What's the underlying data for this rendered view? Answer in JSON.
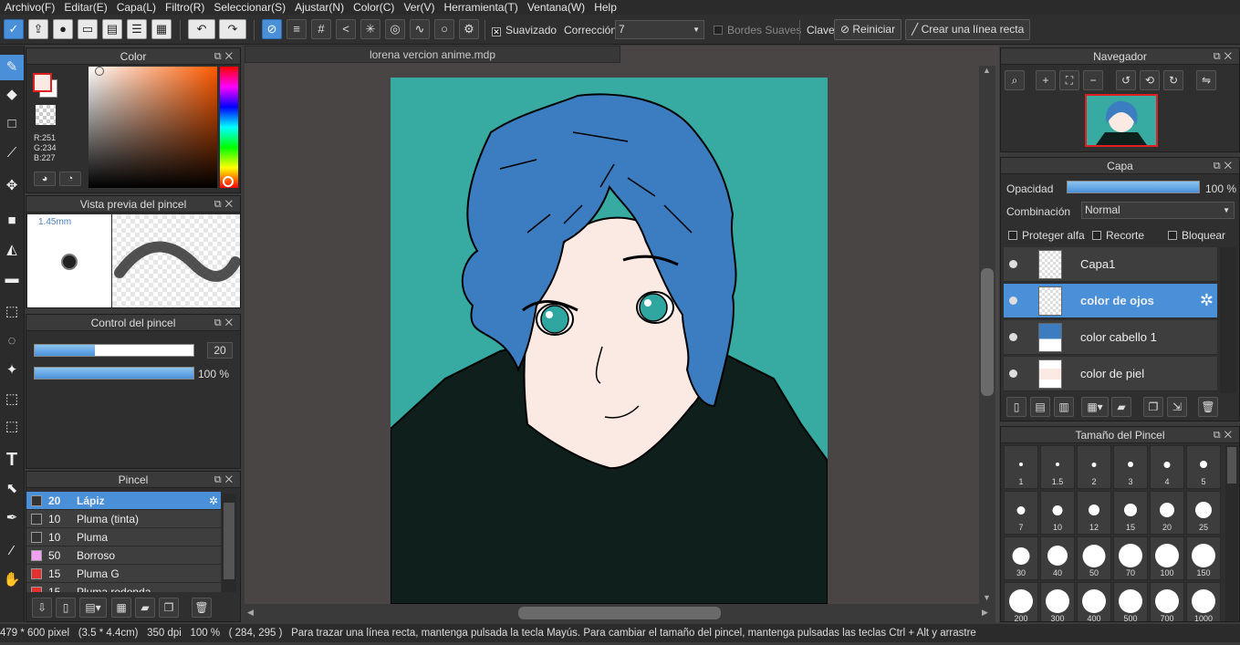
{
  "menu": [
    "Archivo(F)",
    "Editar(E)",
    "Capa(L)",
    "Filtro(R)",
    "Seleccionar(S)",
    "Ajustar(N)",
    "Color(C)",
    "Ver(V)",
    "Herramienta(T)",
    "Ventana(W)",
    "Help"
  ],
  "toolbar": {
    "smoothing_label": "Suavizado",
    "correction_label": "Corrección",
    "correction_value": "7",
    "soft_edges_label": "Bordes Suaves",
    "key_label": "Clave",
    "reset_label": "Reiniciar",
    "line_label": "Crear una línea recta"
  },
  "color_panel": {
    "title": "Color",
    "r": "R:251",
    "g": "G:234",
    "b": "B:227",
    "fg_color": "#fbeae3",
    "bg_color": "#ffffff"
  },
  "brush_preview": {
    "title": "Vista previa del pincel",
    "size": "1.45mm"
  },
  "brush_control": {
    "title": "Control del pincel",
    "size_value": "20",
    "opacity_value": "100 %",
    "size_fraction": 0.38,
    "opacity_fraction": 1.0
  },
  "pincel": {
    "title": "Pincel",
    "items": [
      {
        "size": "20",
        "name": "Lápiz",
        "color": "#333333"
      },
      {
        "size": "10",
        "name": "Pluma (tinta)",
        "color": "#333333"
      },
      {
        "size": "10",
        "name": "Pluma",
        "color": "#333333"
      },
      {
        "size": "50",
        "name": "Borroso",
        "color": "#f0a0f0"
      },
      {
        "size": "15",
        "name": "Pluma G",
        "color": "#e53030"
      },
      {
        "size": "15",
        "name": "Pluma redonda",
        "color": "#e53030"
      }
    ]
  },
  "document": {
    "tab": "lorena vercion anime.mdp",
    "bg_color": "#37aaa2"
  },
  "navigator": {
    "title": "Navegador"
  },
  "layers": {
    "title": "Capa",
    "opacity_label": "Opacidad",
    "opacity_value": "100 %",
    "blend_label": "Combinación",
    "blend_value": "Normal",
    "protect_alpha": "Proteger alfa",
    "clipping": "Recorte",
    "lock": "Bloquear",
    "items": [
      {
        "name": "Capa1"
      },
      {
        "name": "color de ojos"
      },
      {
        "name": "color cabello 1"
      },
      {
        "name": "color de piel"
      }
    ]
  },
  "brush_size": {
    "title": "Tamaño del Pincel",
    "sizes": [
      "1",
      "1.5",
      "2",
      "3",
      "4",
      "5",
      "7",
      "10",
      "12",
      "15",
      "20",
      "25",
      "30",
      "40",
      "50",
      "70",
      "100",
      "150",
      "200",
      "300",
      "400",
      "500",
      "700",
      "1000"
    ]
  },
  "status": {
    "dims": "479 * 600 pixel",
    "cm": "(3.5 * 4.4cm)",
    "dpi": "350 dpi",
    "zoom": "100 %",
    "coords": "( 284, 295 )",
    "hint": "Para trazar una línea recta, mantenga pulsada la tecla Mayús. Para cambiar el tamaño del pincel, mantenga pulsadas las teclas Ctrl + Alt y arrastre"
  }
}
